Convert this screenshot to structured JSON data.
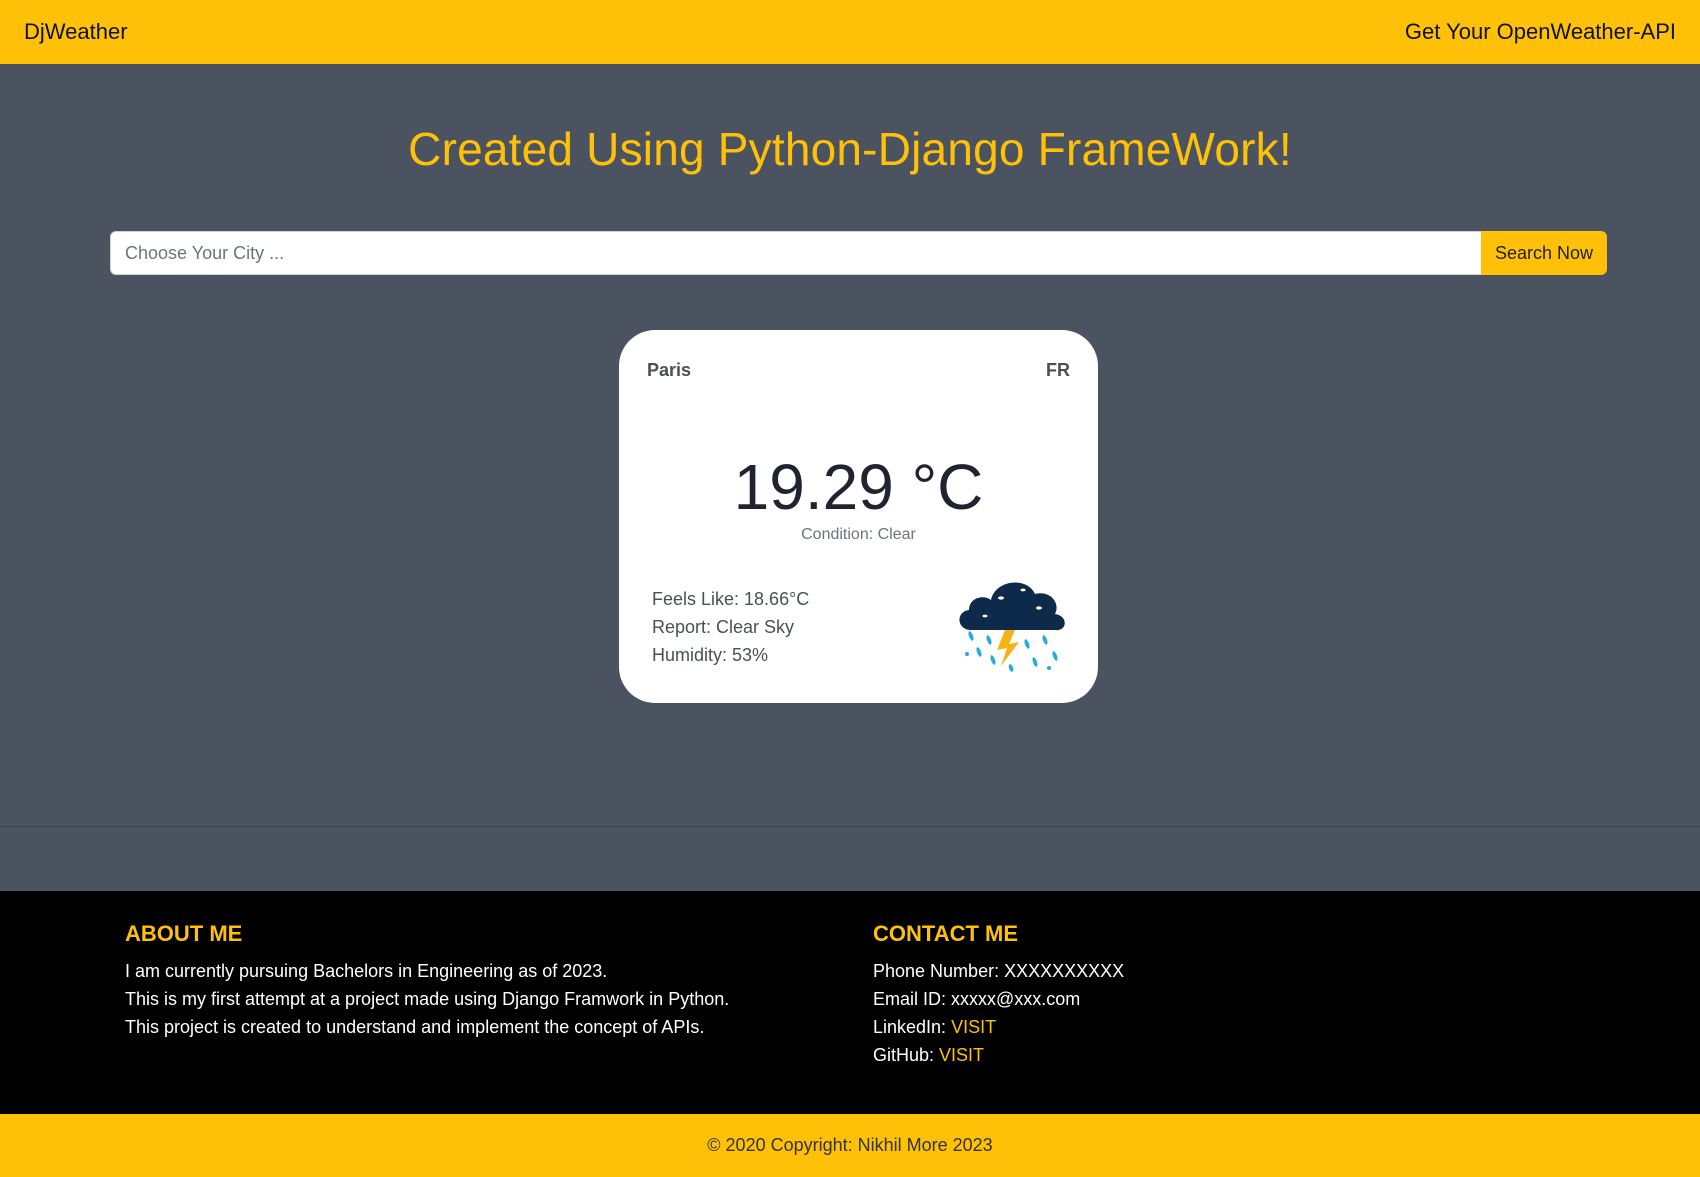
{
  "navbar": {
    "brand": "DjWeather",
    "api_link": "Get Your OpenWeather-API"
  },
  "hero": {
    "title": "Created Using Python-Django FrameWork!"
  },
  "search": {
    "placeholder": "Choose Your City ...",
    "button_label": "Search Now"
  },
  "weather_card": {
    "city": "Paris",
    "country": "FR",
    "temperature": "19.29 °C",
    "condition": "Condition: Clear",
    "feels_like": "Feels Like: 18.66°C",
    "report": "Report: Clear Sky",
    "humidity": "Humidity: 53%",
    "icon": "storm-cloud-icon"
  },
  "footer": {
    "about": {
      "heading": "ABOUT ME",
      "lines": [
        "I am currently pursuing Bachelors in Engineering as of 2023.",
        "This is my first attempt at a project made using Django Framwork in Python.",
        "This project is created to understand and implement the concept of APIs."
      ]
    },
    "contact": {
      "heading": "CONTACT ME",
      "phone": "Phone Number: XXXXXXXXXX",
      "email": "Email ID: xxxxx@xxx.com",
      "linkedin_label": "LinkedIn: ",
      "linkedin_link": "VISIT",
      "github_label": "GitHub: ",
      "github_link": "VISIT"
    }
  },
  "copyright": "© 2020 Copyright: Nikhil More 2023",
  "colors": {
    "accent": "#ffc107",
    "background": "#4b5260",
    "footer": "#000000"
  }
}
